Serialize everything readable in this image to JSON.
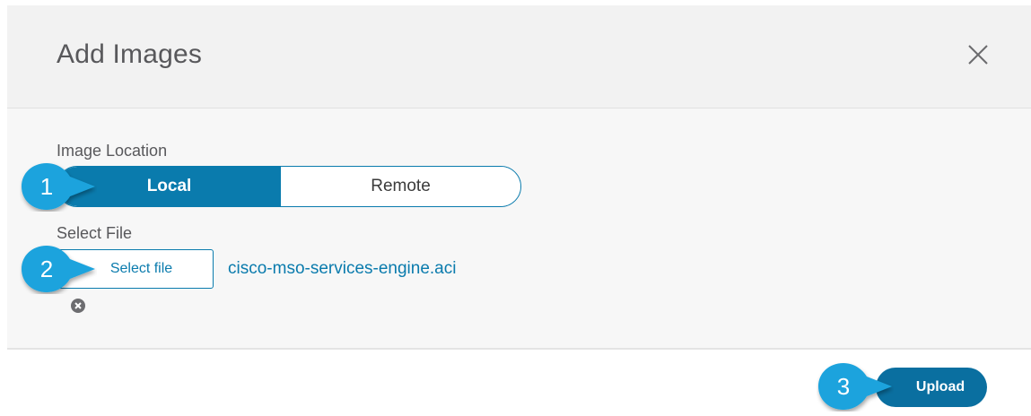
{
  "dialog": {
    "title": "Add Images",
    "close_icon": "close-icon"
  },
  "image_location": {
    "label": "Image Location",
    "options": [
      {
        "label": "Local",
        "selected": true
      },
      {
        "label": "Remote",
        "selected": false
      }
    ]
  },
  "select_file": {
    "label": "Select File",
    "button_label": "Select file",
    "file_name": "cisco-mso-services-engine.aci",
    "remove_icon": "remove-circle-icon"
  },
  "footer": {
    "upload_label": "Upload"
  },
  "callouts": [
    {
      "number": "1"
    },
    {
      "number": "2"
    },
    {
      "number": "3"
    }
  ],
  "colors": {
    "accent": "#0a7bad",
    "callout": "#1aa3dd"
  }
}
